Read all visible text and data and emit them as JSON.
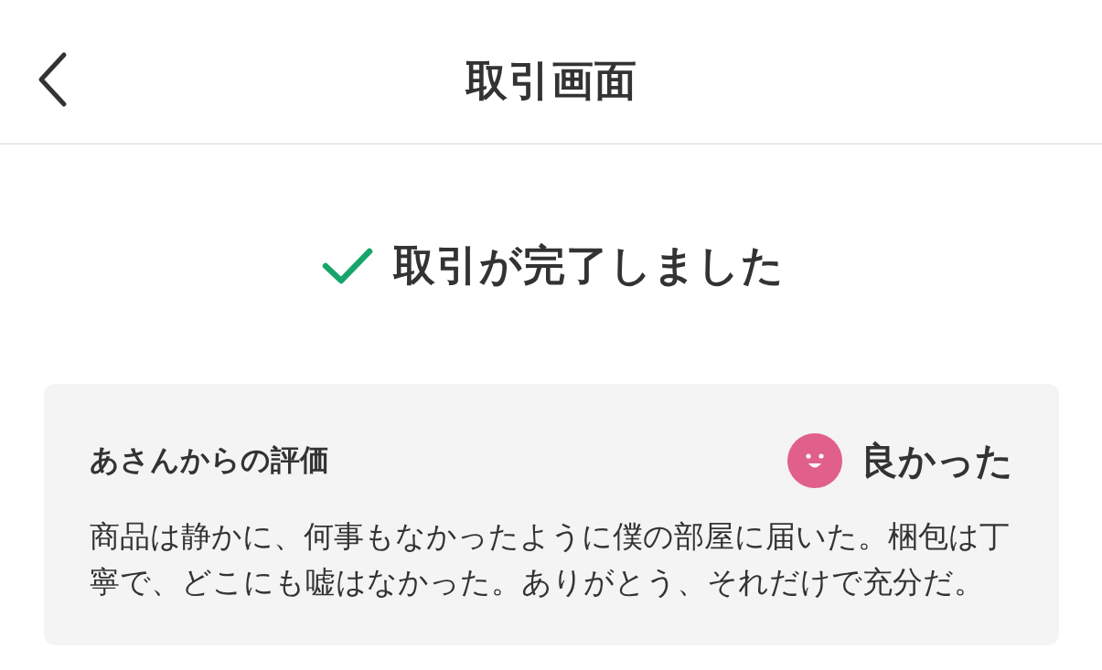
{
  "header": {
    "title": "取引画面"
  },
  "status": {
    "kind": "completed",
    "message": "取引が完了しました"
  },
  "review": {
    "heading": "あさんからの評価",
    "rating": {
      "kind": "good",
      "label": "良かった"
    },
    "comment": "商品は静かに、何事もなかったように僕の部屋に届いた。梱包は丁寧で、どこにも嘘はなかった。ありがとう、それだけで充分だ。"
  }
}
